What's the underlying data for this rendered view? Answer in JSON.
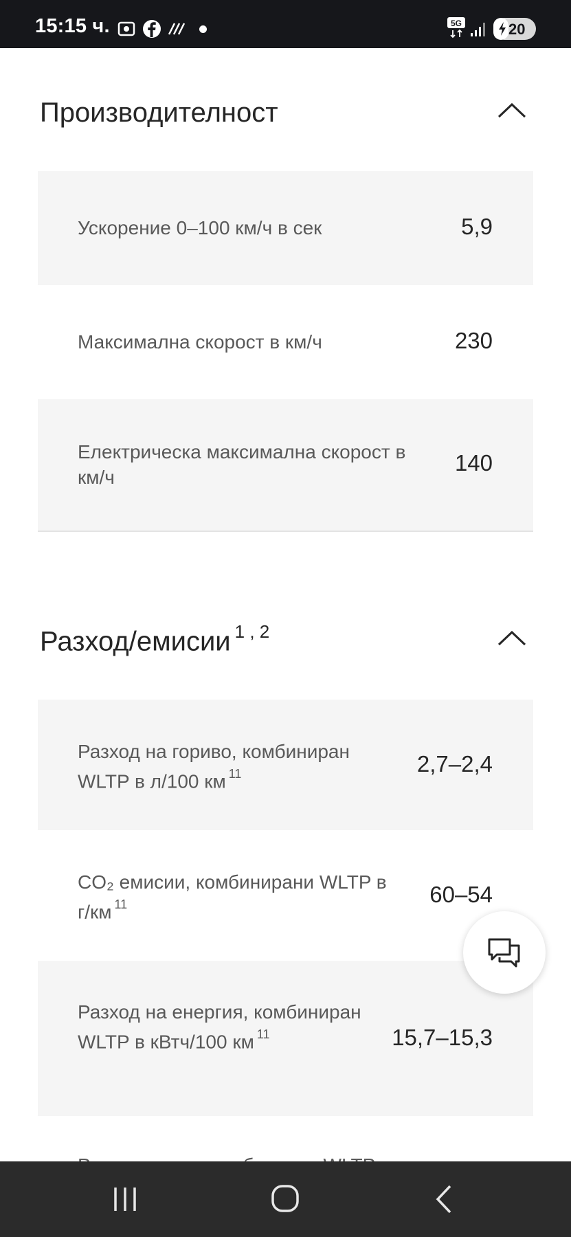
{
  "status_bar": {
    "time": "15:15 ч.",
    "network": "5G",
    "battery_level": "20",
    "icons": [
      "screenshot-icon",
      "facebook-icon",
      "data-saver-icon",
      "dot-icon",
      "5g-icon",
      "signal-icon",
      "battery-icon"
    ]
  },
  "performance": {
    "title": "Производителност",
    "rows": [
      {
        "label": "Ускорение 0–100 км/ч в сек",
        "value": "5,9"
      },
      {
        "label": "Максимална скорост в км/ч",
        "value": "230"
      },
      {
        "label": "Електрическа максимална скорост в км/ч",
        "value": "140"
      }
    ]
  },
  "consumption": {
    "title": "Разход/емисии",
    "title_sup": "1 , 2",
    "rows": [
      {
        "label": "Разход на гориво, комбиниран WLTP в л/100 км",
        "sup": "11",
        "value": "2,7–2,4"
      },
      {
        "label": "CO₂ емисии, комбинирани WLTP в г/км",
        "sup": "11",
        "value": "60–54"
      },
      {
        "label": "Разход на енергия, комбиниран WLTP в кВтч/100 км",
        "sup": "11",
        "value": "15,7–15,3"
      }
    ]
  },
  "peek_row": {
    "label": "Разход на ток, комбиниран WLTP"
  },
  "chat": {
    "icon": "chat-bubbles-icon"
  },
  "nav": {
    "icons": [
      "recent-apps-icon",
      "home-icon",
      "back-icon"
    ]
  }
}
